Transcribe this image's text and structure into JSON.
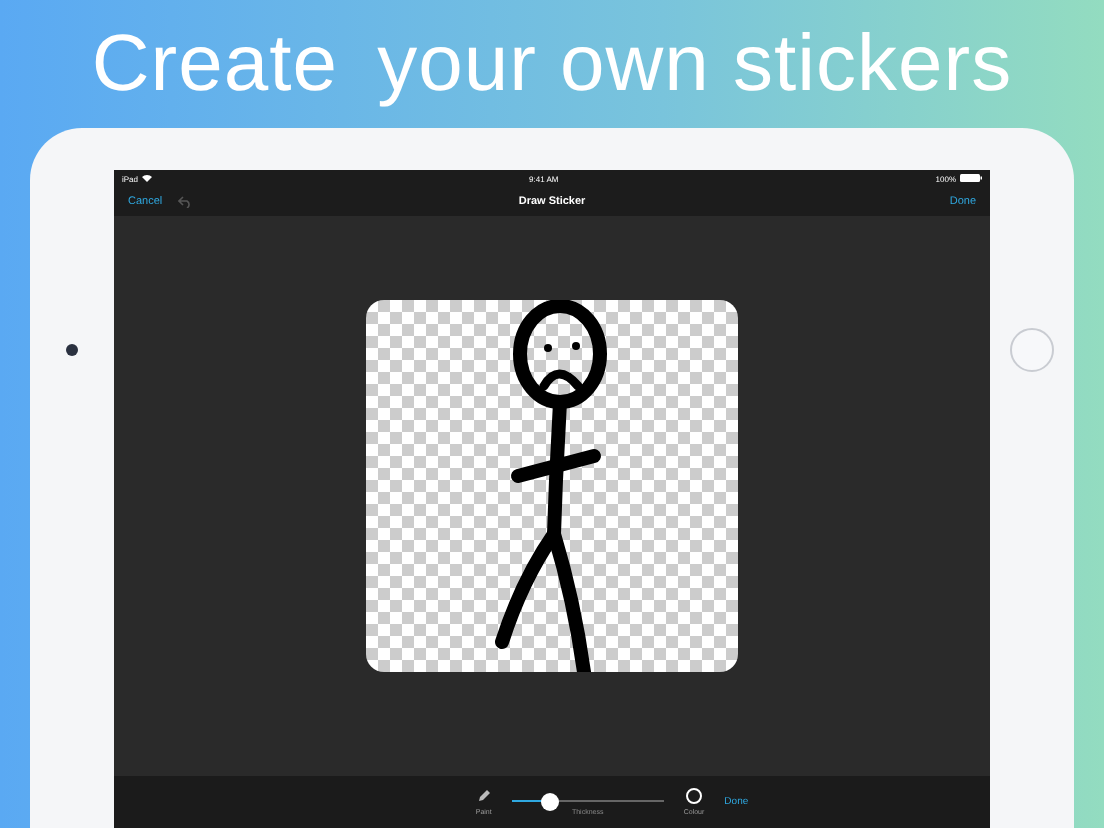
{
  "headline": {
    "lead": "Create",
    "rest": "your own stickers"
  },
  "status_bar": {
    "carrier": "iPad",
    "time": "9:41 AM",
    "battery": "100%"
  },
  "nav_bar": {
    "left": "Cancel",
    "title": "Draw Sticker",
    "right": "Done"
  },
  "toolbar": {
    "paint": "Paint",
    "thickness": {
      "label": "Thickness",
      "level": 0.25
    },
    "colour": "Colour",
    "done": "Done"
  }
}
